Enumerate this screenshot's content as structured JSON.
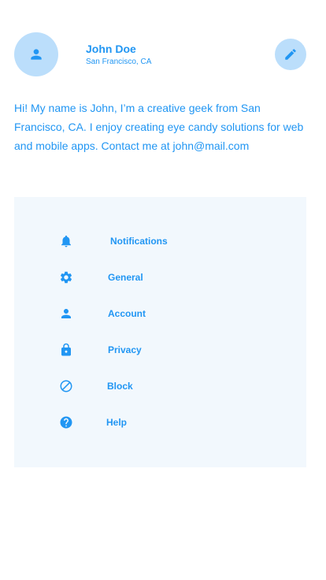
{
  "profile": {
    "name": "John Doe",
    "location": "San Francisco, CA",
    "bio": "Hi! My name is John, I’m a creative geek from San Francisco, CA. I enjoy creating eye candy solutions for web and mobile apps. Contact me at john@mail.com",
    "avatar_icon": "person-icon",
    "edit_icon": "pencil-icon"
  },
  "colors": {
    "accent": "#2196f3",
    "accent_light": "#bbdefb",
    "panel_bg": "#f2f8fd"
  },
  "menu": {
    "items": [
      {
        "label": "Notifications",
        "icon": "bell-icon"
      },
      {
        "label": "General",
        "icon": "gear-icon"
      },
      {
        "label": "Account",
        "icon": "person-icon"
      },
      {
        "label": "Privacy",
        "icon": "lock-icon"
      },
      {
        "label": "Block",
        "icon": "block-icon"
      },
      {
        "label": "Help",
        "icon": "help-icon"
      }
    ]
  }
}
